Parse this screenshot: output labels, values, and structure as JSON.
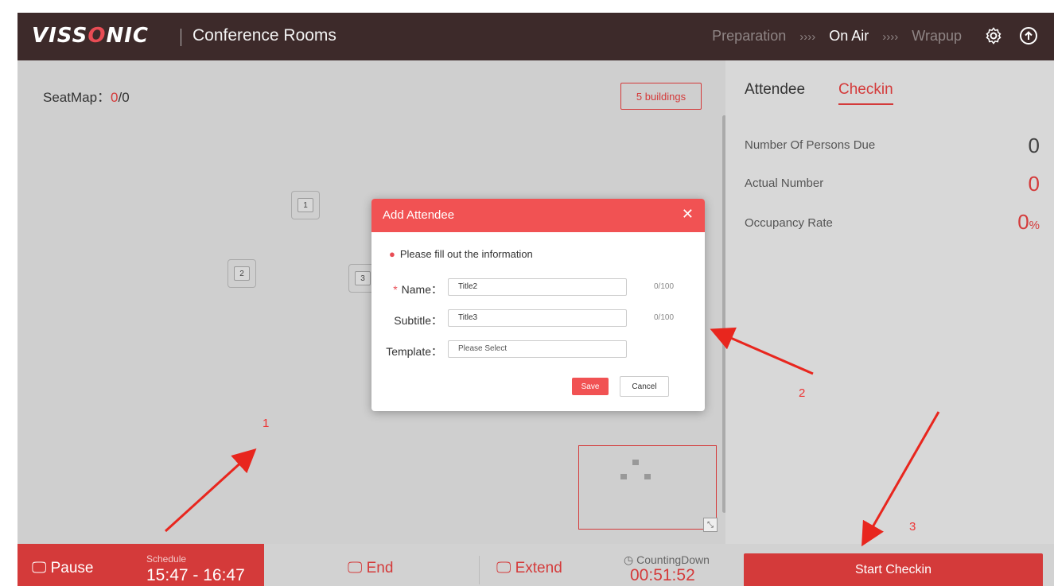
{
  "header": {
    "logo": "VISSONIC",
    "app_title": "Conference Rooms",
    "steps": [
      "Preparation",
      "On Air",
      "Wrapup"
    ],
    "step_separator": "››››",
    "active_step": "On Air",
    "icons": [
      "gear-icon",
      "upload-circle-icon"
    ]
  },
  "seatmap": {
    "label": "SeatMap：",
    "count_current": "0",
    "count_total": "/0",
    "buildings_button": "5 buildings",
    "seats": [
      "1",
      "2",
      "3"
    ]
  },
  "side": {
    "tabs": [
      "Attendee",
      "Checkin"
    ],
    "active_tab": "Checkin",
    "stats": [
      {
        "label": "Number Of Persons Due",
        "value": "0"
      },
      {
        "label": "Actual Number",
        "value": "0"
      },
      {
        "label": "Occupancy Rate",
        "value": "0",
        "unit": "%"
      }
    ]
  },
  "modal": {
    "title": "Add Attendee",
    "close": "✕",
    "hint": "Please fill out the information",
    "fields": [
      {
        "label": "Name：",
        "required": "*",
        "value": "Title2",
        "counter": "0/100"
      },
      {
        "label": "Subtitle：",
        "value": "Title3",
        "counter": "0/100"
      },
      {
        "label": "Template：",
        "value": "Please Select"
      }
    ],
    "save": "Save",
    "cancel": "Cancel"
  },
  "bottom": {
    "pause": "Pause",
    "schedule_label": "Schedule",
    "schedule_time": "15:47 - 16:47",
    "end": "End",
    "extend": "Extend",
    "countdown_label": "CountingDown",
    "countdown_value": "00:51:52",
    "start_checkin": "Start Checkin"
  },
  "annotations": [
    "1",
    "2",
    "3"
  ],
  "colors": {
    "accent": "#d43a3a",
    "header": "#3d2a2a",
    "modal_header": "#f15253"
  }
}
